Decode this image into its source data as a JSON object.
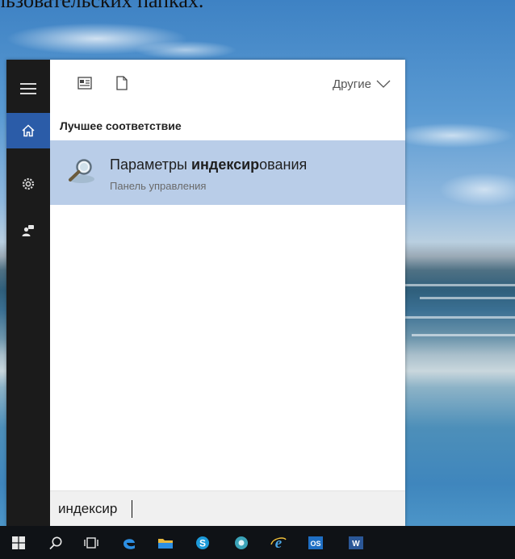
{
  "document": {
    "caption": "льзовательских папках."
  },
  "start_menu": {
    "rail": {
      "items": [
        {
          "icon": "hamburger-menu-icon"
        },
        {
          "icon": "home-icon",
          "active": true
        },
        {
          "icon": "settings-gear-icon"
        },
        {
          "icon": "feedback-person-icon"
        }
      ]
    },
    "toolbar": {
      "apps_filter_icon": "apps-filter-icon",
      "documents_filter_icon": "documents-filter-icon",
      "other_label": "Другие"
    },
    "best_match": {
      "section_title": "Лучшее соответствие",
      "result": {
        "title_prefix": "Параметры ",
        "title_match": "индексир",
        "title_suffix": "ования",
        "subtitle": "Панель управления",
        "icon": "indexing-options-icon"
      }
    },
    "search": {
      "value": "индексир"
    }
  },
  "taskbar": {
    "items": [
      {
        "name": "windows-start-icon"
      },
      {
        "name": "search-icon"
      },
      {
        "name": "task-view-icon"
      },
      {
        "name": "edge-icon"
      },
      {
        "name": "file-explorer-icon"
      },
      {
        "name": "skype-icon"
      },
      {
        "name": "chrome-icon"
      },
      {
        "name": "internet-explorer-icon"
      },
      {
        "name": "outlook-icon"
      },
      {
        "name": "word-icon"
      }
    ]
  },
  "colors": {
    "accent": "#2b5ca8",
    "result_highlight": "#b9cde8",
    "rail_background": "#1b1b1b",
    "taskbar_background": "#0f1216"
  }
}
